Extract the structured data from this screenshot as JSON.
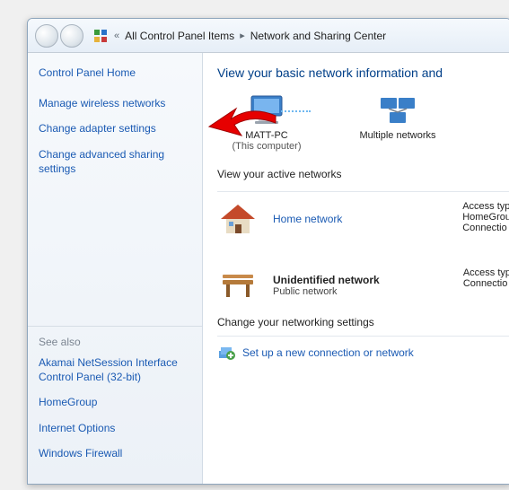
{
  "breadcrumb": {
    "back_chevron": "«",
    "root": "All Control Panel Items",
    "current": "Network and Sharing Center"
  },
  "sidebar": {
    "home": "Control Panel Home",
    "links": [
      "Manage wireless networks",
      "Change adapter settings",
      "Change advanced sharing settings"
    ],
    "seealso_hdr": "See also",
    "seealso": [
      "Akamai NetSession Interface Control Panel (32-bit)",
      "HomeGroup",
      "Internet Options",
      "Windows Firewall"
    ]
  },
  "main": {
    "heading": "View your basic network information and",
    "topology": {
      "computer": {
        "name": "MATT-PC",
        "sub": "(This computer)"
      },
      "networks": {
        "name": "Multiple networks"
      }
    },
    "active_hdr": "View your active networks",
    "access_lines": {
      "a": "Access typ",
      "b": "HomeGrou",
      "c": "Connectio",
      "d": "Access typ",
      "e": "Connectio"
    },
    "networks_list": [
      {
        "title": "Home network",
        "sub": "",
        "link": true
      },
      {
        "title": "Unidentified network",
        "sub": "Public network",
        "link": false
      }
    ],
    "change_hdr": "Change your networking settings",
    "task1": "Set up a new connection or network"
  }
}
